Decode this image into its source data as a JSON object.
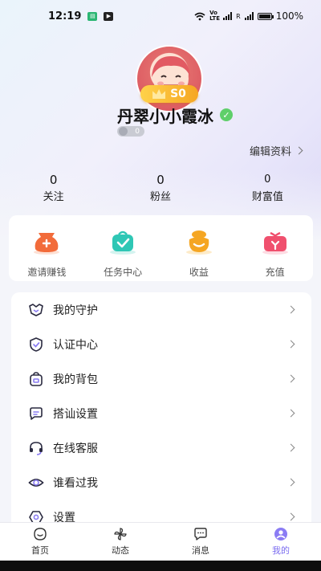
{
  "status_bar": {
    "time": "12:19",
    "battery": "100%",
    "network_label": "Vo LTE",
    "battery_level": 1.0
  },
  "profile": {
    "name": "丹翠小小霞冰",
    "badge_label": "S0",
    "level": "0",
    "edit_label": "编辑资料"
  },
  "stats": [
    {
      "value": "0",
      "label": "关注"
    },
    {
      "value": "0",
      "label": "粉丝"
    },
    {
      "value": "0",
      "label": "财富值"
    }
  ],
  "shortcuts": [
    {
      "label": "邀请赚钱",
      "icon": "money-bag-icon",
      "color": "#f26b3a"
    },
    {
      "label": "任务中心",
      "icon": "task-bag-icon",
      "color": "#2fc7b5"
    },
    {
      "label": "收益",
      "icon": "coin-pouch-icon",
      "color": "#f5a623"
    },
    {
      "label": "充值",
      "icon": "gift-box-icon",
      "color": "#f0506e"
    }
  ],
  "menu": [
    {
      "label": "我的守护",
      "icon": "guard-icon"
    },
    {
      "label": "认证中心",
      "icon": "shield-check-icon"
    },
    {
      "label": "我的背包",
      "icon": "backpack-icon"
    },
    {
      "label": "搭讪设置",
      "icon": "chat-bubble-icon"
    },
    {
      "label": "在线客服",
      "icon": "headset-icon"
    },
    {
      "label": "谁看过我",
      "icon": "eye-icon"
    },
    {
      "label": "设置",
      "icon": "settings-icon"
    }
  ],
  "tabs": [
    {
      "label": "首页",
      "icon": "home-icon",
      "active": false
    },
    {
      "label": "动态",
      "icon": "pinwheel-icon",
      "active": false
    },
    {
      "label": "消息",
      "icon": "message-icon",
      "active": false
    },
    {
      "label": "我的",
      "icon": "profile-icon",
      "active": true
    }
  ],
  "colors": {
    "accent": "#7b6cf0",
    "verified": "#5fcf6a",
    "badge": "#f5a623"
  }
}
